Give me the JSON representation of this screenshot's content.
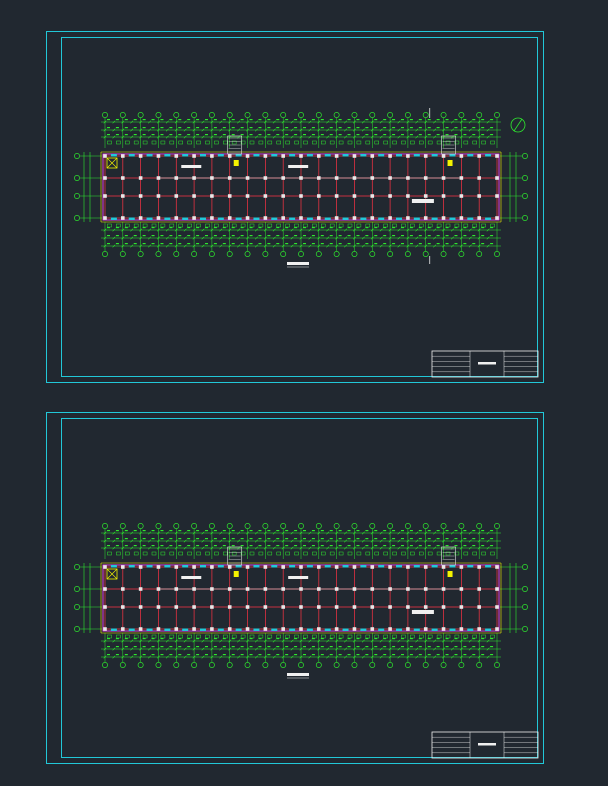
{
  "canvas": {
    "background": "#212830"
  },
  "colors": {
    "frame": "#22c8d8",
    "dimension": "#2ee82e",
    "grid": "#ff3344",
    "column": "#e8e8e8",
    "wall": "#e040e0",
    "stair": "#f4f400",
    "text": "#f0f0f0"
  },
  "sheets": [
    {
      "id": "upper",
      "grid_columns": 23,
      "grid_rows": 4,
      "section_mark": "1",
      "has_north_arrow": true
    },
    {
      "id": "lower",
      "grid_columns": 23,
      "grid_rows": 4,
      "section_mark": "",
      "has_north_arrow": false
    }
  ]
}
